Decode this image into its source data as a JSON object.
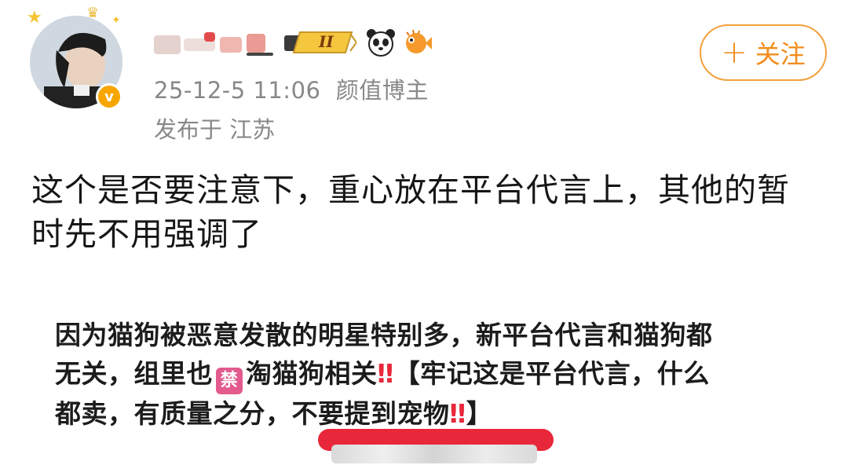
{
  "user": {
    "avatar_icon": "avatar-icon",
    "verified_icon": "verified-v-icon",
    "verified_glyph": "v",
    "level_badge_text": "II",
    "emoji_icons": [
      "panda-icon",
      "pufferfish-icon"
    ]
  },
  "post": {
    "timestamp": "25-12-5 11:06",
    "category": "颜值博主",
    "location_label": "发布于 江苏",
    "follow_label": "关注",
    "follow_icon": "plus-icon",
    "text": "这个是否要注意下，重心放在平台代言上，其他的暂时先不用强调了"
  },
  "quote": {
    "line1": "因为猫狗被恶意发散的明星特别多，新平台代言和猫狗都",
    "line2a": "无关，组里也",
    "ban_glyph": "禁",
    "line2b": "淘猫狗相关",
    "excl": "‼",
    "line2c": "【牢记这是平台代言，什么",
    "line3a": "都卖，有质量之分，不要提到宠物",
    "line3b": "】"
  },
  "colors": {
    "accent_orange": "#f28c1a",
    "highlight_red": "#e8283a",
    "ban_pink": "#e35a8d",
    "meta_gray": "#888888"
  }
}
